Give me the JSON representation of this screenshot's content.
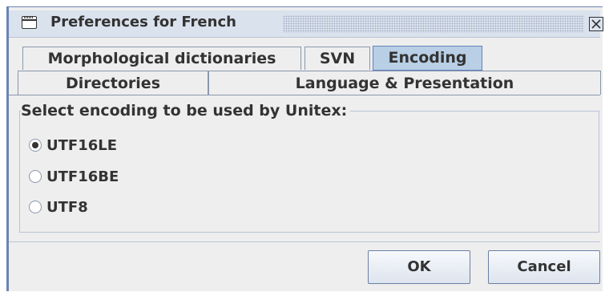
{
  "window": {
    "title": "Preferences for French",
    "close_glyph": "✕"
  },
  "tabs_row1": [
    "Morphological dictionaries",
    "SVN",
    "Encoding"
  ],
  "tabs_row2": [
    "Directories",
    "Language & Presentation"
  ],
  "selected_tab": "Encoding",
  "encoding": {
    "group_label": "Select encoding to be used by Unitex:",
    "options": [
      "UTF16LE",
      "UTF16BE",
      "UTF8"
    ],
    "selected": "UTF16LE"
  },
  "buttons": {
    "ok": "OK",
    "cancel": "Cancel"
  },
  "colors": {
    "accent": "#6382bf",
    "selected_tab": "#b8cfe5",
    "titlebar": "#dae2ee"
  }
}
